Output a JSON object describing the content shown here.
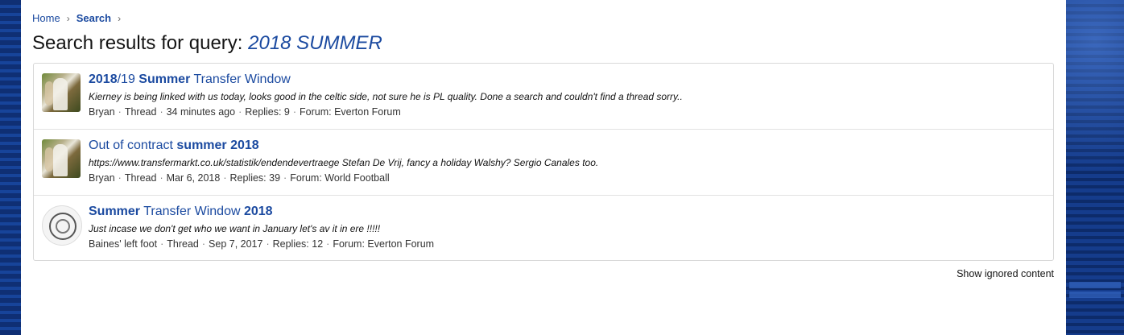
{
  "breadcrumb": {
    "home": "Home",
    "search": "Search"
  },
  "title": {
    "prefix": "Search results for query:",
    "query": "2018 SUMMER"
  },
  "results": [
    {
      "title_parts": [
        {
          "t": "2018",
          "b": true
        },
        {
          "t": "/19 ",
          "b": false
        },
        {
          "t": "Summer",
          "b": true
        },
        {
          "t": " Transfer Window",
          "b": false
        }
      ],
      "snippet": "Kierney is being linked with us today, looks good in the celtic side, not sure he is PL quality. Done a search and couldn't find a thread sorry..",
      "author": "Bryan",
      "type": "Thread",
      "date": "34 minutes ago",
      "replies": "Replies: 9",
      "forum": "Forum: Everton Forum",
      "avatar": "photo"
    },
    {
      "title_parts": [
        {
          "t": "Out of contract ",
          "b": false
        },
        {
          "t": "summer",
          "b": true
        },
        {
          "t": " ",
          "b": false
        },
        {
          "t": "2018",
          "b": true
        }
      ],
      "snippet": "https://www.transfermarkt.co.uk/statistik/endendevertraege Stefan De Vrij, fancy a holiday Walshy? Sergio Canales too.",
      "author": "Bryan",
      "type": "Thread",
      "date": "Mar 6, 2018",
      "replies": "Replies: 39",
      "forum": "Forum: World Football",
      "avatar": "photo"
    },
    {
      "title_parts": [
        {
          "t": "Summer",
          "b": true
        },
        {
          "t": " Transfer Window ",
          "b": false
        },
        {
          "t": "2018",
          "b": true
        }
      ],
      "snippet": "Just incase we don't get who we want in January let's av it in ere !!!!!",
      "author": "Baines' left foot",
      "type": "Thread",
      "date": "Sep 7, 2017",
      "replies": "Replies: 12",
      "forum": "Forum: Everton Forum",
      "avatar": "sketch"
    }
  ],
  "show_ignored": "Show ignored content",
  "colors": {
    "link": "#1b4aa0",
    "bg_blue": "#123a86"
  },
  "icons": {
    "breadcrumb_separator": "chevron-right-icon"
  }
}
